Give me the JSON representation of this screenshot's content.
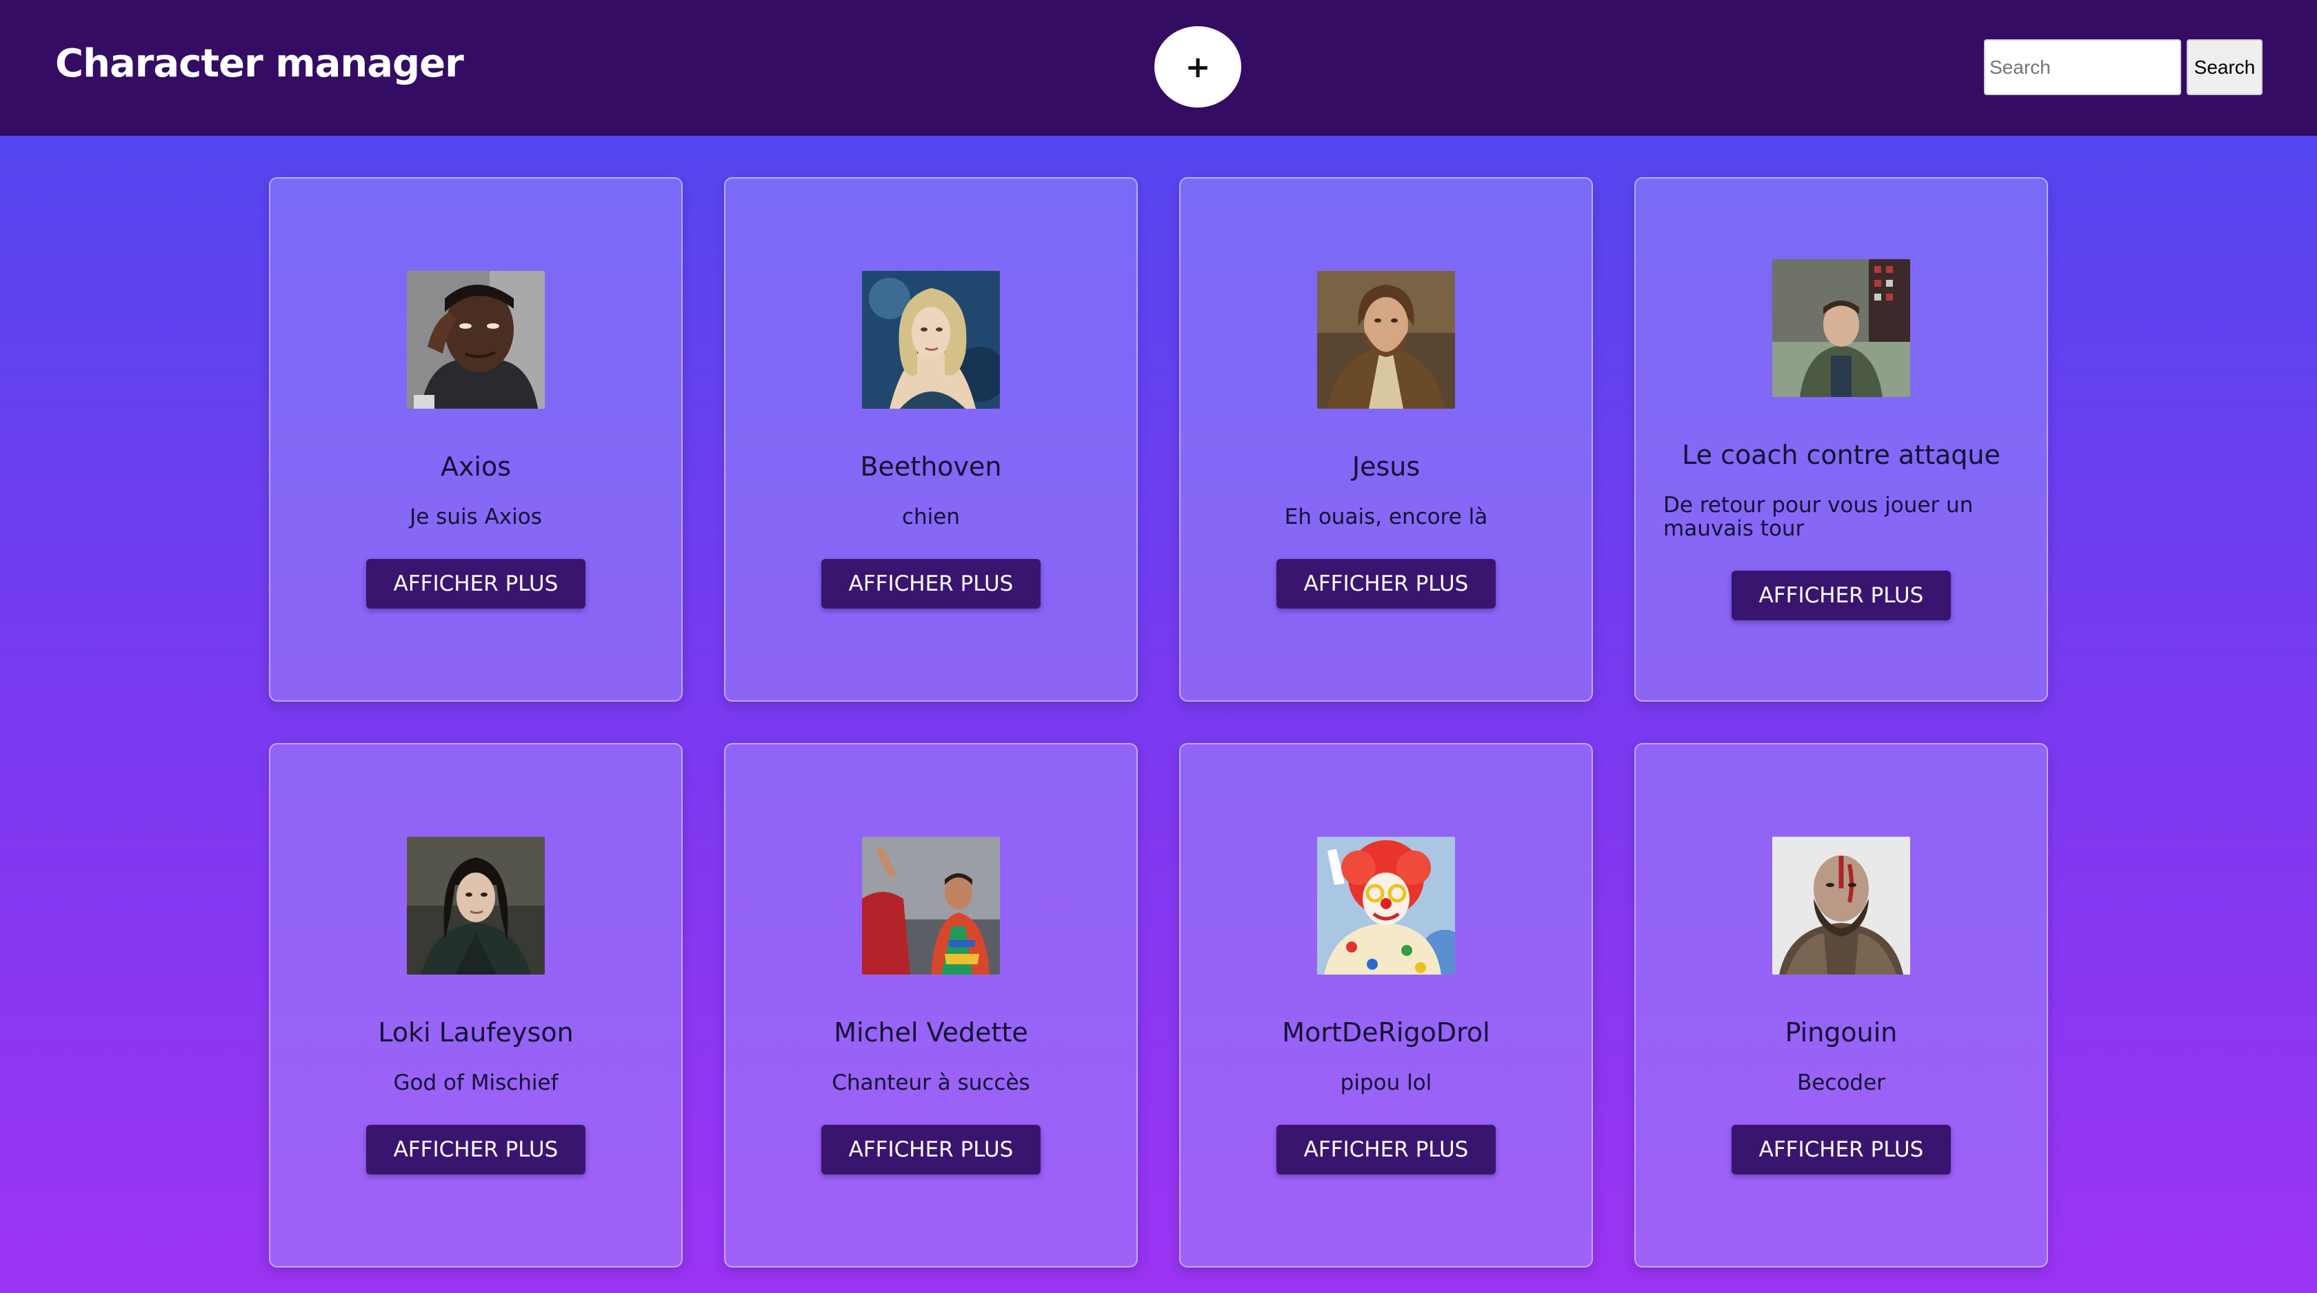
{
  "header": {
    "title": "Character manager",
    "add_label": "+",
    "search_placeholder": "Search",
    "search_button": "Search"
  },
  "colors": {
    "header_bg": "#340c63",
    "button_bg": "#3a1570",
    "page_gradient_top": "#4c49ef",
    "page_gradient_bottom": "#9b34f2"
  },
  "cards": [
    {
      "name": "Axios",
      "description": "Je suis Axios",
      "button": "AFFICHER PLUS",
      "avatar": "meme-man-photo"
    },
    {
      "name": "Beethoven",
      "description": "chien",
      "button": "AFFICHER PLUS",
      "avatar": "blonde-woman-photo"
    },
    {
      "name": "Jesus",
      "description": "Eh ouais, encore là",
      "button": "AFFICHER PLUS",
      "avatar": "robed-man-photo"
    },
    {
      "name": "Le coach contre attaque",
      "description": "De retour pour vous jouer un mauvais tour",
      "button": "AFFICHER PLUS",
      "avatar": "man-in-chair-photo"
    },
    {
      "name": "Loki Laufeyson",
      "description": "God of Mischief",
      "button": "AFFICHER PLUS",
      "avatar": "dark-haired-man-photo"
    },
    {
      "name": "Michel Vedette",
      "description": "Chanteur à succès",
      "button": "AFFICHER PLUS",
      "avatar": "singer-stage-photo"
    },
    {
      "name": "MortDeRigoDrol",
      "description": "pipou lol",
      "button": "AFFICHER PLUS",
      "avatar": "clown-photo"
    },
    {
      "name": "Pingouin",
      "description": "Becoder",
      "button": "AFFICHER PLUS",
      "avatar": "bearded-warrior-photo"
    }
  ]
}
